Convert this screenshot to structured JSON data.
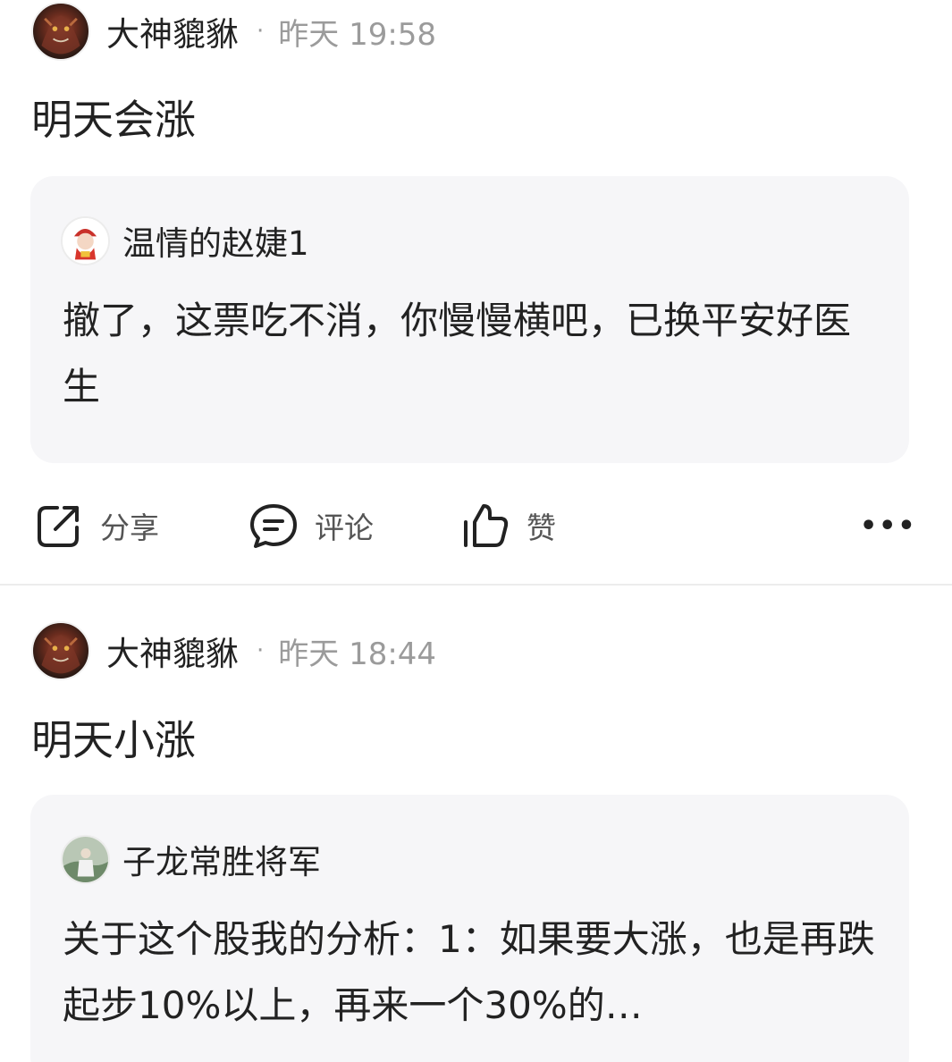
{
  "posts": [
    {
      "author": "大神貔貅",
      "separator": "·",
      "time": "昨天 19:58",
      "content": "明天会涨",
      "quote": {
        "author": "温情的赵婕1",
        "text": "撤了，这票吃不消，你慢慢横吧，已换平安好医生"
      },
      "actions": {
        "share": "分享",
        "comment": "评论",
        "like": "赞"
      }
    },
    {
      "author": "大神貔貅",
      "separator": "·",
      "time": "昨天 18:44",
      "content": "明天小涨",
      "quote": {
        "author": "子龙常胜将军",
        "text": "关于这个股我的分析：1：如果要大涨，也是再跌起步10%以上，再来一个30%的…"
      }
    }
  ],
  "icons": {
    "share": "share-icon",
    "comment": "comment-icon",
    "like": "thumbs-up-icon",
    "more": "more-icon"
  }
}
